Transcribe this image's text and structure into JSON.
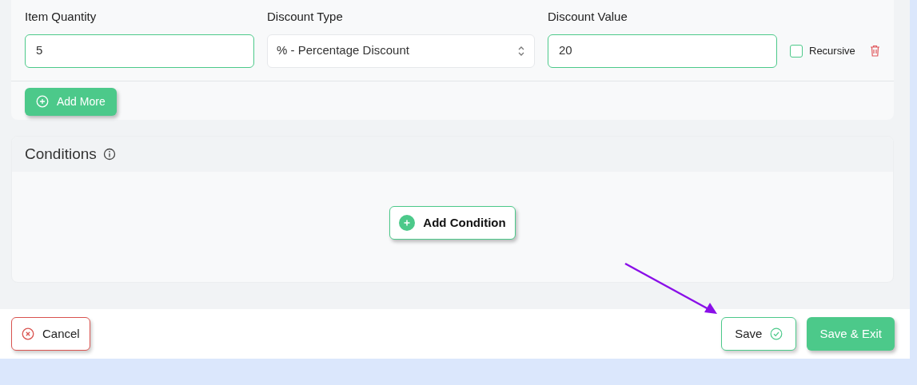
{
  "discount_rows": [
    {
      "fields": [
        {
          "kind": "input",
          "label": "Item Quantity",
          "value": "5"
        },
        {
          "kind": "select",
          "label": "Discount Type",
          "value": "% - Percentage Discount"
        },
        {
          "kind": "input",
          "label": "Discount Value",
          "value": "20"
        }
      ],
      "recursive": {
        "label": "Recursive",
        "checked": false
      }
    }
  ],
  "add_more": {
    "label": "Add More"
  },
  "conditions": {
    "title": "Conditions",
    "add_condition": {
      "label": "Add Condition"
    }
  },
  "footer": {
    "cancel": "Cancel",
    "save": "Save",
    "save_exit": "Save & Exit"
  }
}
